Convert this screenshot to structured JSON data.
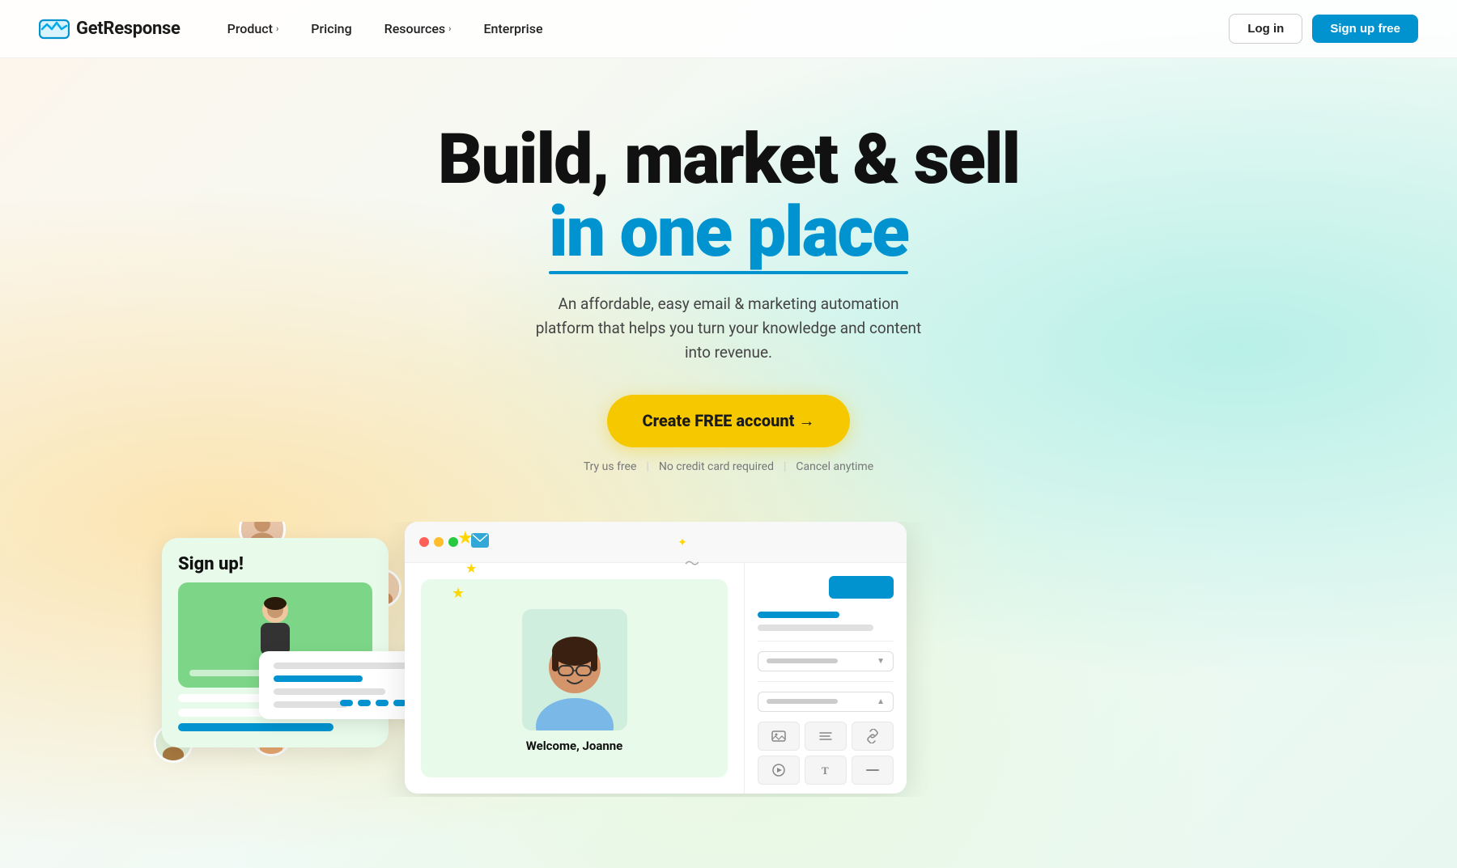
{
  "brand": {
    "name": "GetResponse",
    "logo_alt": "GetResponse logo"
  },
  "nav": {
    "product_label": "Product",
    "product_chevron": "›",
    "pricing_label": "Pricing",
    "resources_label": "Resources",
    "resources_chevron": "›",
    "enterprise_label": "Enterprise",
    "login_label": "Log in",
    "signup_label": "Sign up free"
  },
  "hero": {
    "title_line1": "Build, market & sell",
    "title_line2": "in one place",
    "subtitle": "An affordable, easy email & marketing automation platform that helps you turn your knowledge and content into revenue.",
    "cta_label": "Create FREE account →",
    "fine_print_1": "Try us free",
    "fine_print_2": "No credit card required",
    "fine_print_3": "Cancel anytime"
  },
  "signup_widget": {
    "title": "Sign up!"
  },
  "email_welcome": {
    "welcome_text": "Welcome, Joanne"
  },
  "colors": {
    "brand_blue": "#0093d0",
    "cta_yellow": "#f5c800",
    "hero_text_blue": "#0093d0",
    "text_dark": "#111111"
  }
}
